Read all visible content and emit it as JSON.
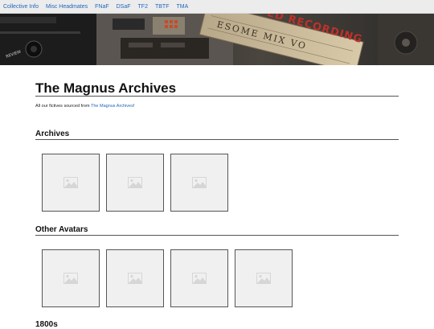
{
  "nav": {
    "items": [
      "Collective Info",
      "Misc Headmates",
      "FNaF",
      "DSaF",
      "TF2",
      "TBTF",
      "TMA"
    ]
  },
  "banner": {
    "cassette_label": "ESOME MIX VO",
    "stamp_text": "ED RECORDING",
    "corner_text": "REVIEW"
  },
  "page": {
    "title": "The Magnus Archives",
    "intro_text": "All our fictives sourced from ",
    "intro_link": "The Magnus Archives",
    "intro_end": "!"
  },
  "sections": [
    {
      "title": "Archives",
      "thumb_count": 3
    },
    {
      "title": "Other Avatars",
      "thumb_count": 4
    },
    {
      "title": "1800s"
    }
  ],
  "colors": {
    "link": "#2266bb",
    "nav_bg": "#ececec",
    "placeholder_bg": "#f0f0f0",
    "placeholder_icon": "#d6d6d6",
    "stamp_red": "#c0302a"
  },
  "icons": {
    "thumbnail": "image-placeholder-icon"
  }
}
